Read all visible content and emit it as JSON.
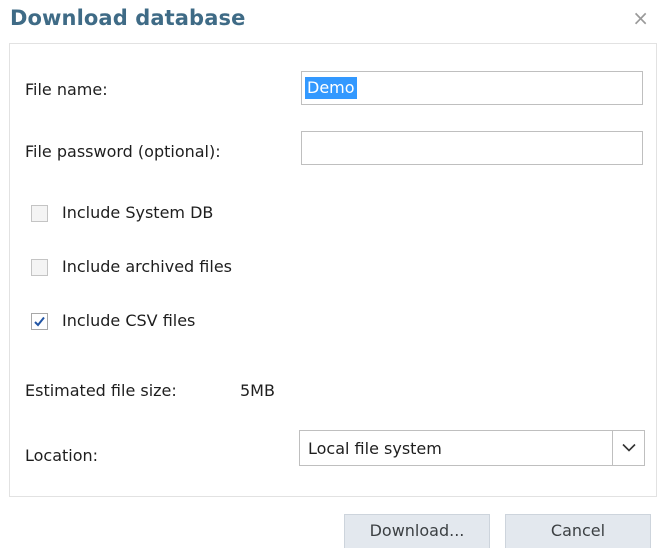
{
  "dialog": {
    "title": "Download database",
    "close_glyph": "×"
  },
  "form": {
    "file_name_label": "File name:",
    "file_name_value": "Demo",
    "file_password_label": "File password (optional):",
    "file_password_value": "",
    "checkboxes": [
      {
        "label": "Include System DB",
        "checked": false
      },
      {
        "label": "Include archived files",
        "checked": false
      },
      {
        "label": "Include CSV files",
        "checked": true
      }
    ],
    "estimated_size_label": "Estimated file size:",
    "estimated_size_value": "5MB",
    "location_label": "Location:",
    "location_value": "Local file system"
  },
  "buttons": {
    "download_label": "Download...",
    "cancel_label": "Cancel"
  },
  "colors": {
    "title": "#3f6b86",
    "selection": "#3399ff",
    "button_bg": "#e3e8ee"
  }
}
